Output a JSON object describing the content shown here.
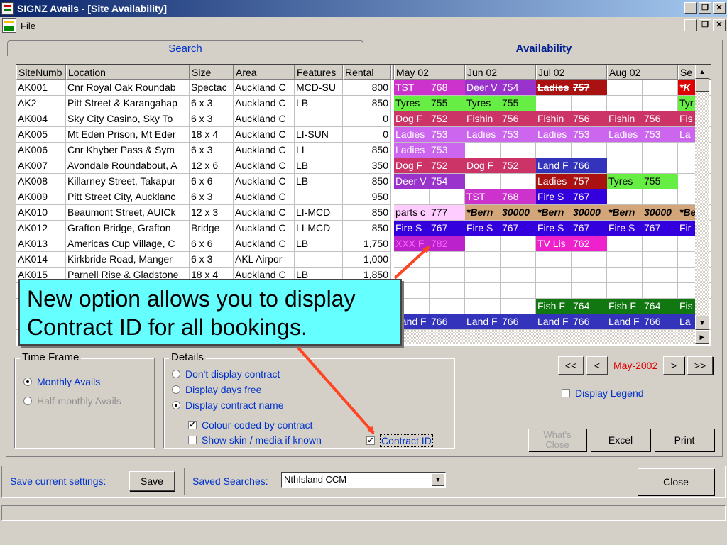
{
  "window": {
    "title": "SIGNZ Avails - [Site Availability]"
  },
  "menu": {
    "file": "File"
  },
  "tabs": {
    "search": "Search",
    "availability": "Availability"
  },
  "columns": [
    "SiteNumb",
    "Location",
    "Size",
    "Area",
    "Features",
    "Rental"
  ],
  "months": [
    "May 02",
    "Jun 02",
    "Jul 02",
    "Aug 02",
    "Se"
  ],
  "rows": [
    [
      "AK001",
      "Cnr Royal Oak Roundab",
      "Spectac",
      "Auckland C",
      "MCD-SU",
      "800"
    ],
    [
      "AK2",
      "Pitt Street & Karangahap",
      "6 x 3",
      "Auckland C",
      "LB",
      "850"
    ],
    [
      "AK004",
      "Sky City Casino, Sky To",
      "6 x 3",
      "Auckland C",
      "",
      "0"
    ],
    [
      "AK005",
      "Mt Eden Prison, Mt Eder",
      "18 x 4",
      "Auckland C",
      "LI-SUN",
      "0"
    ],
    [
      "AK006",
      "Cnr Khyber Pass & Sym",
      "6 x 3",
      "Auckland C",
      "LI",
      "850"
    ],
    [
      "AK007",
      "Avondale Roundabout, A",
      "12 x 6",
      "Auckland C",
      "LB",
      "350"
    ],
    [
      "AK008",
      "Killarney Street, Takapur",
      "6 x 6",
      "Auckland C",
      "LB",
      "850"
    ],
    [
      "AK009",
      "Pitt Street City, Aucklanc",
      "6 x 3",
      "Auckland C",
      "",
      "950"
    ],
    [
      "AK010",
      "Beaumont Street, AUICk",
      "12 x 3",
      "Auckland C",
      "LI-MCD",
      "850"
    ],
    [
      "AK012",
      "Grafton Bridge, Grafton",
      "Bridge",
      "Auckland C",
      "LI-MCD",
      "850"
    ],
    [
      "AK013",
      "Americas Cup Village, C",
      "6 x 6",
      "Auckland C",
      "LB",
      "1,750"
    ],
    [
      "AK014",
      "Kirkbride Road, Manger",
      "6 x 3",
      "AKL Airpor",
      "",
      "1,000"
    ],
    [
      "AK015",
      "Parnell Rise & Gladstone",
      "18 x 4",
      "Auckland C",
      "LB",
      "1,850"
    ]
  ],
  "bookings": [
    {
      "row": 0,
      "slot": 0,
      "name": "TST",
      "id": "768",
      "bg": "#cc33cc",
      "fg": "#ffffff",
      "style": ""
    },
    {
      "row": 0,
      "slot": 1,
      "name": "Deer V",
      "id": "754",
      "bg": "#9933cc",
      "fg": "#ffffff",
      "style": ""
    },
    {
      "row": 0,
      "slot": 2,
      "name": "Ladies",
      "id": "757",
      "bg": "#aa1111",
      "fg": "#ffffff",
      "style": "strike"
    },
    {
      "row": 0,
      "slot": 4,
      "name": "*K",
      "id": "",
      "bg": "#dd0000",
      "fg": "#ffffff",
      "style": "italicbold"
    },
    {
      "row": 1,
      "slot": 0,
      "name": "Tyres",
      "id": "755",
      "bg": "#66ee44",
      "fg": "#000000",
      "style": ""
    },
    {
      "row": 1,
      "slot": 1,
      "name": "Tyres",
      "id": "755",
      "bg": "#66ee44",
      "fg": "#000000",
      "style": ""
    },
    {
      "row": 1,
      "slot": 4,
      "name": "Tyr",
      "id": "",
      "bg": "#66ee44",
      "fg": "#000000",
      "style": ""
    },
    {
      "row": 2,
      "slot": 0,
      "name": "Dog F",
      "id": "752",
      "bg": "#cc3366",
      "fg": "#ffffff",
      "style": ""
    },
    {
      "row": 2,
      "slot": 1,
      "name": "Fishin",
      "id": "756",
      "bg": "#cc3366",
      "fg": "#ffffff",
      "style": ""
    },
    {
      "row": 2,
      "slot": 2,
      "name": "Fishin",
      "id": "756",
      "bg": "#cc3366",
      "fg": "#ffffff",
      "style": ""
    },
    {
      "row": 2,
      "slot": 3,
      "name": "Fishin",
      "id": "756",
      "bg": "#cc3366",
      "fg": "#ffffff",
      "style": ""
    },
    {
      "row": 2,
      "slot": 4,
      "name": "Fis",
      "id": "",
      "bg": "#cc3366",
      "fg": "#ffffff",
      "style": ""
    },
    {
      "row": 3,
      "slot": 0,
      "name": "Ladies",
      "id": "753",
      "bg": "#cc66ee",
      "fg": "#ffffff",
      "style": ""
    },
    {
      "row": 3,
      "slot": 1,
      "name": "Ladies",
      "id": "753",
      "bg": "#cc66ee",
      "fg": "#ffffff",
      "style": ""
    },
    {
      "row": 3,
      "slot": 2,
      "name": "Ladies",
      "id": "753",
      "bg": "#cc66ee",
      "fg": "#ffffff",
      "style": ""
    },
    {
      "row": 3,
      "slot": 3,
      "name": "Ladies",
      "id": "753",
      "bg": "#cc66ee",
      "fg": "#ffffff",
      "style": ""
    },
    {
      "row": 3,
      "slot": 4,
      "name": "La",
      "id": "",
      "bg": "#cc66ee",
      "fg": "#ffffff",
      "style": ""
    },
    {
      "row": 4,
      "slot": 0,
      "name": "Ladies",
      "id": "753",
      "bg": "#cc66ee",
      "fg": "#ffffff",
      "style": ""
    },
    {
      "row": 5,
      "slot": 0,
      "name": "Dog F",
      "id": "752",
      "bg": "#cc3366",
      "fg": "#ffffff",
      "style": ""
    },
    {
      "row": 5,
      "slot": 1,
      "name": "Dog F",
      "id": "752",
      "bg": "#cc3366",
      "fg": "#ffffff",
      "style": ""
    },
    {
      "row": 5,
      "slot": 2,
      "name": "Land F",
      "id": "766",
      "bg": "#3333bb",
      "fg": "#ffffff",
      "style": ""
    },
    {
      "row": 6,
      "slot": 0,
      "name": "Deer V",
      "id": "754",
      "bg": "#9933cc",
      "fg": "#ffffff",
      "style": ""
    },
    {
      "row": 6,
      "slot": 2,
      "name": "Ladies",
      "id": "757",
      "bg": "#aa1111",
      "fg": "#ffffff",
      "style": ""
    },
    {
      "row": 6,
      "slot": 3,
      "name": "Tyres",
      "id": "755",
      "bg": "#66ee44",
      "fg": "#000000",
      "style": ""
    },
    {
      "row": 7,
      "slot": 1,
      "name": "TST",
      "id": "768",
      "bg": "#cc33cc",
      "fg": "#ffffff",
      "style": ""
    },
    {
      "row": 7,
      "slot": 2,
      "name": "Fire S",
      "id": "767",
      "bg": "#3300dd",
      "fg": "#ffffff",
      "style": ""
    },
    {
      "row": 8,
      "slot": 0,
      "name": "parts c",
      "id": "777",
      "bg": "#ffccff",
      "fg": "#000000",
      "style": ""
    },
    {
      "row": 8,
      "slot": 1,
      "name": "*Bern",
      "id": "30000",
      "bg": "#d2a679",
      "fg": "#000000",
      "style": "italicbold"
    },
    {
      "row": 8,
      "slot": 2,
      "name": "*Bern",
      "id": "30000",
      "bg": "#d2a679",
      "fg": "#000000",
      "style": "italicbold"
    },
    {
      "row": 8,
      "slot": 3,
      "name": "*Bern",
      "id": "30000",
      "bg": "#d2a679",
      "fg": "#000000",
      "style": "italicbold"
    },
    {
      "row": 8,
      "slot": 4,
      "name": "*Be",
      "id": "",
      "bg": "#d2a679",
      "fg": "#000000",
      "style": "italicbold"
    },
    {
      "row": 9,
      "slot": 0,
      "name": "Fire S",
      "id": "767",
      "bg": "#3300dd",
      "fg": "#ffffff",
      "style": ""
    },
    {
      "row": 9,
      "slot": 1,
      "name": "Fire S",
      "id": "767",
      "bg": "#3300dd",
      "fg": "#ffffff",
      "style": ""
    },
    {
      "row": 9,
      "slot": 2,
      "name": "Fire S",
      "id": "767",
      "bg": "#3300dd",
      "fg": "#ffffff",
      "style": ""
    },
    {
      "row": 9,
      "slot": 3,
      "name": "Fire S",
      "id": "767",
      "bg": "#3300dd",
      "fg": "#ffffff",
      "style": ""
    },
    {
      "row": 9,
      "slot": 4,
      "name": "Fir",
      "id": "",
      "bg": "#3300dd",
      "fg": "#ffffff",
      "style": ""
    },
    {
      "row": 10,
      "slot": 0,
      "name": "XXX F",
      "id": "782",
      "bg": "#bb22cc",
      "fg": "#ff66ff",
      "style": ""
    },
    {
      "row": 10,
      "slot": 2,
      "name": "TV Lis",
      "id": "762",
      "bg": "#ee22cc",
      "fg": "#ffffff",
      "style": ""
    },
    {
      "row": 14,
      "slot": 2,
      "name": "Fish F",
      "id": "764",
      "bg": "#117711",
      "fg": "#ffffff",
      "style": ""
    },
    {
      "row": 14,
      "slot": 3,
      "name": "Fish F",
      "id": "764",
      "bg": "#117711",
      "fg": "#ffffff",
      "style": ""
    },
    {
      "row": 14,
      "slot": 4,
      "name": "Fis",
      "id": "",
      "bg": "#117711",
      "fg": "#ffffff",
      "style": ""
    },
    {
      "row": 15,
      "slot": 0,
      "name": "Land F",
      "id": "766",
      "bg": "#3333bb",
      "fg": "#ffffff",
      "style": ""
    },
    {
      "row": 15,
      "slot": 1,
      "name": "Land F",
      "id": "766",
      "bg": "#3333bb",
      "fg": "#ffffff",
      "style": ""
    },
    {
      "row": 15,
      "slot": 2,
      "name": "Land F",
      "id": "766",
      "bg": "#3333bb",
      "fg": "#ffffff",
      "style": ""
    },
    {
      "row": 15,
      "slot": 3,
      "name": "Land F",
      "id": "766",
      "bg": "#3333bb",
      "fg": "#ffffff",
      "style": ""
    },
    {
      "row": 15,
      "slot": 4,
      "name": "La",
      "id": "",
      "bg": "#3333bb",
      "fg": "#ffffff",
      "style": ""
    }
  ],
  "callout": {
    "line1": "New option allows you to display",
    "line2": "Contract ID for all bookings."
  },
  "timeframe": {
    "label": "Time Frame",
    "monthly": "Monthly Avails",
    "halfmonthly": "Half-monthly Avails"
  },
  "details": {
    "label": "Details",
    "no_contract": "Don't display contract",
    "days_free": "Display days free",
    "contract_name": "Display contract name",
    "colour_coded": "Colour-coded by contract",
    "show_skin": "Show skin / media if known",
    "contract_id": "Contract ID"
  },
  "nav": {
    "first": "<<",
    "prev": "<",
    "current": "May-2002",
    "next": ">",
    "last": ">>",
    "legend": "Display Legend"
  },
  "buttons": {
    "whats_close_line1": "What's",
    "whats_close_line2": "Close",
    "excel": "Excel",
    "print": "Print",
    "close": "Close",
    "save": "Save"
  },
  "bottom": {
    "save_label": "Save current settings:",
    "saved_label": "Saved Searches:",
    "saved_value": "NthIsland CCM"
  },
  "colors": {
    "accent_text": "#0033cc",
    "callout_bg": "#66ffff",
    "arrow": "#ff4422",
    "nav_current": "#dd0000"
  }
}
